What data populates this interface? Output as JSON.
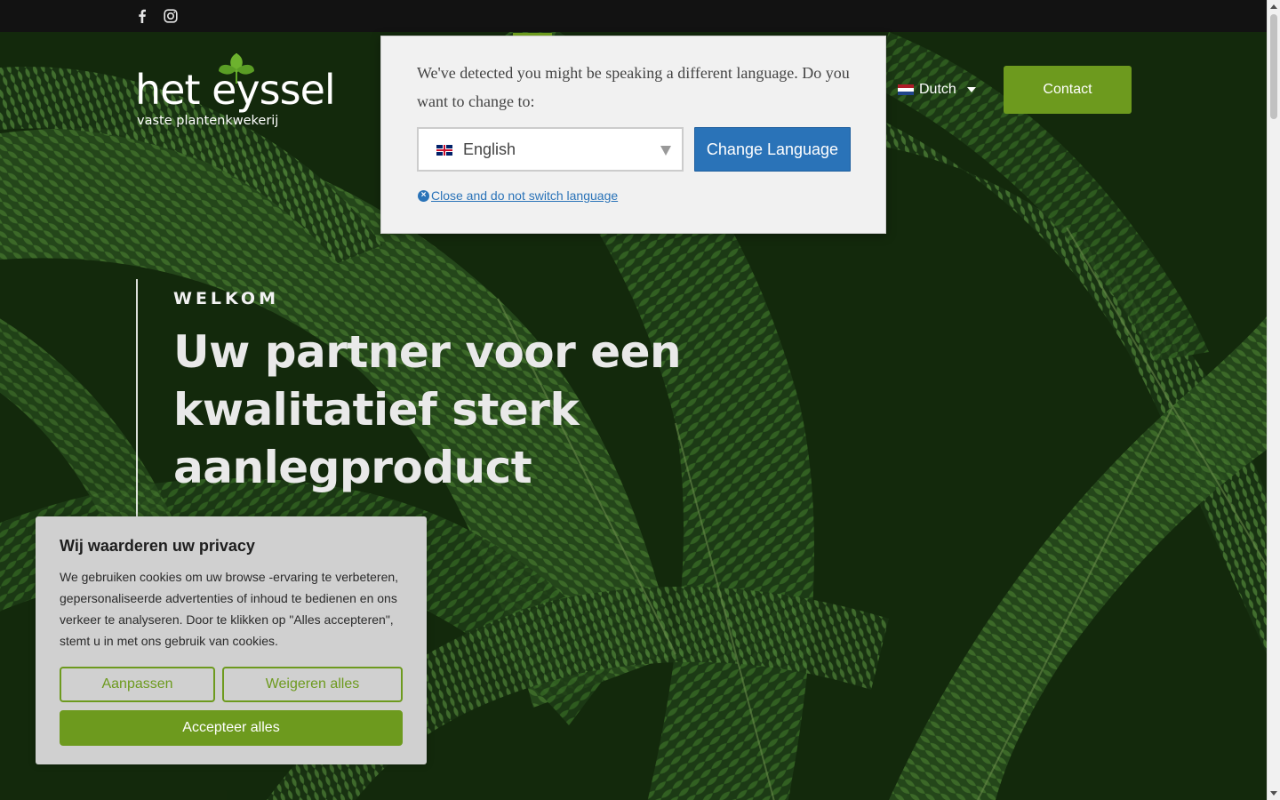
{
  "topbar": {
    "social": [
      {
        "name": "facebook-icon"
      },
      {
        "name": "instagram-icon"
      }
    ]
  },
  "brand": {
    "name": "het eyssel",
    "tagline": "vaste plantenkwekerij"
  },
  "header": {
    "language": "Dutch",
    "contact_label": "Contact"
  },
  "language_modal": {
    "message": "We've detected you might be speaking a different language. Do you want to change to:",
    "selected_language": "English",
    "change_label": "Change Language",
    "close_label": "Close and do not switch language"
  },
  "hero": {
    "eyebrow": "WELKOM",
    "headline": "Uw partner voor een kwalitatief sterk aanlegproduct"
  },
  "cookie_banner": {
    "title": "Wij waarderen uw privacy",
    "text": "We gebruiken cookies om uw browse -ervaring te verbeteren, gepersonaliseerde advertenties of inhoud te bedienen en ons verkeer te analyseren. Door te klikken op \"Alles accepteren\", stemt u in met ons gebruik van cookies.",
    "customize_label": "Aanpassen",
    "reject_label": "Weigeren alles",
    "accept_label": "Accepteer alles"
  },
  "colors": {
    "brand_green": "#6d9a1e",
    "link_blue": "#2a73b8",
    "topbar": "#121212"
  }
}
